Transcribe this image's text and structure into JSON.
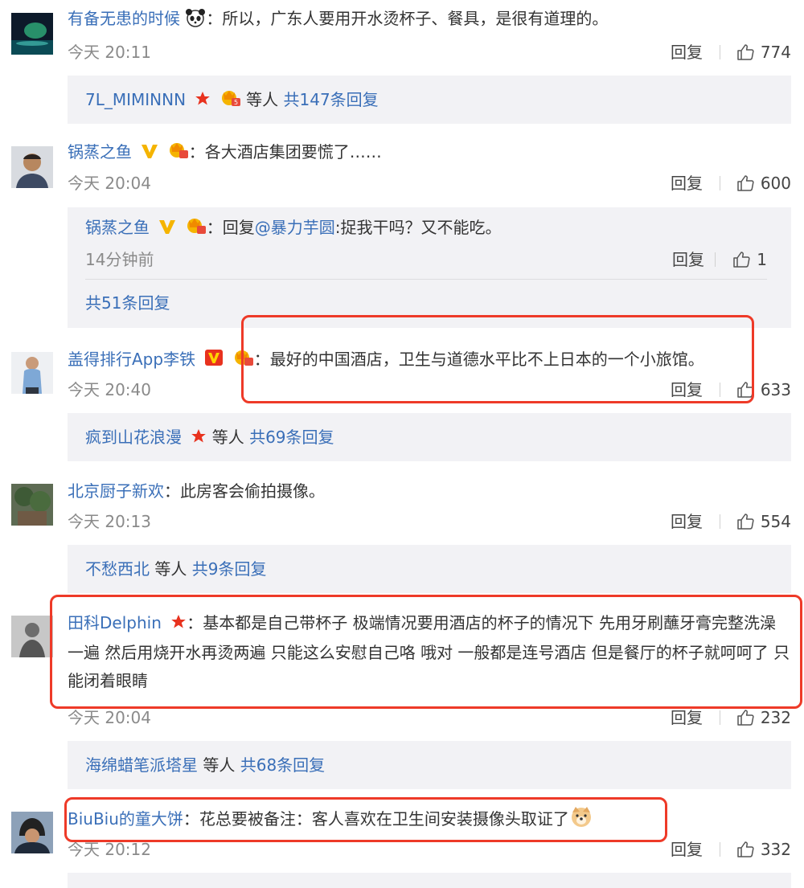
{
  "colors": {
    "name": "#eb7350",
    "link": "#3a6fb8",
    "highlight": "#ee3a28",
    "sub_bg": "#f2f2f5"
  },
  "reply_label": "回复",
  "comments": [
    {
      "user": "有备无患的时候",
      "text": "：所以，广东人要用开水烫杯子、餐具，是很有道理的。",
      "time": "今天 20:11",
      "likes": "774",
      "summary": {
        "users": "7L_MIMINNN",
        "etc": "等人",
        "total": "共147条回复"
      }
    },
    {
      "user": "锅蒸之鱼",
      "text": "：各大酒店集团要慌了……",
      "time": "今天 20:04",
      "likes": "600",
      "nested": {
        "user": "锅蒸之鱼",
        "prefix": "：回复",
        "mention": "@暴力芋圆",
        "text": ":捉我干吗？又不能吃。",
        "time": "14分钟前",
        "likes": "1",
        "total": "共51条回复"
      }
    },
    {
      "user": "盖得排行App李铁",
      "text": "：最好的中国酒店，卫生与道德水平比不上日本的一个小旅馆。",
      "time": "今天 20:40",
      "likes": "633",
      "summary": {
        "users": "疯到山花浪漫",
        "etc": "等人",
        "total": "共69条回复"
      }
    },
    {
      "user": "北京厨子新欢",
      "text": "：此房客会偷拍摄像。",
      "time": "今天 20:13",
      "likes": "554",
      "summary": {
        "users": "不愁西北",
        "etc": "等人",
        "total": "共9条回复"
      }
    },
    {
      "user": "田科Delphin",
      "text": "：基本都是自己带杯子 极端情况要用酒店的杯子的情况下 先用牙刷蘸牙膏完整洗澡一遍 然后用烧开水再烫两遍 只能这么安慰自己咯 哦对 一般都是连号酒店 但是餐厅的杯子就呵呵了 只能闭着眼睛",
      "time": "今天 20:04",
      "likes": "232",
      "summary": {
        "users": "海绵蜡笔派塔星",
        "etc": "等人",
        "total": "共68条回复"
      }
    },
    {
      "user": "BiuBiu的童大饼",
      "text": "：花总要被备注：客人喜欢在卫生间安装摄像头取证了",
      "time": "今天 20:12",
      "likes": "332"
    }
  ]
}
